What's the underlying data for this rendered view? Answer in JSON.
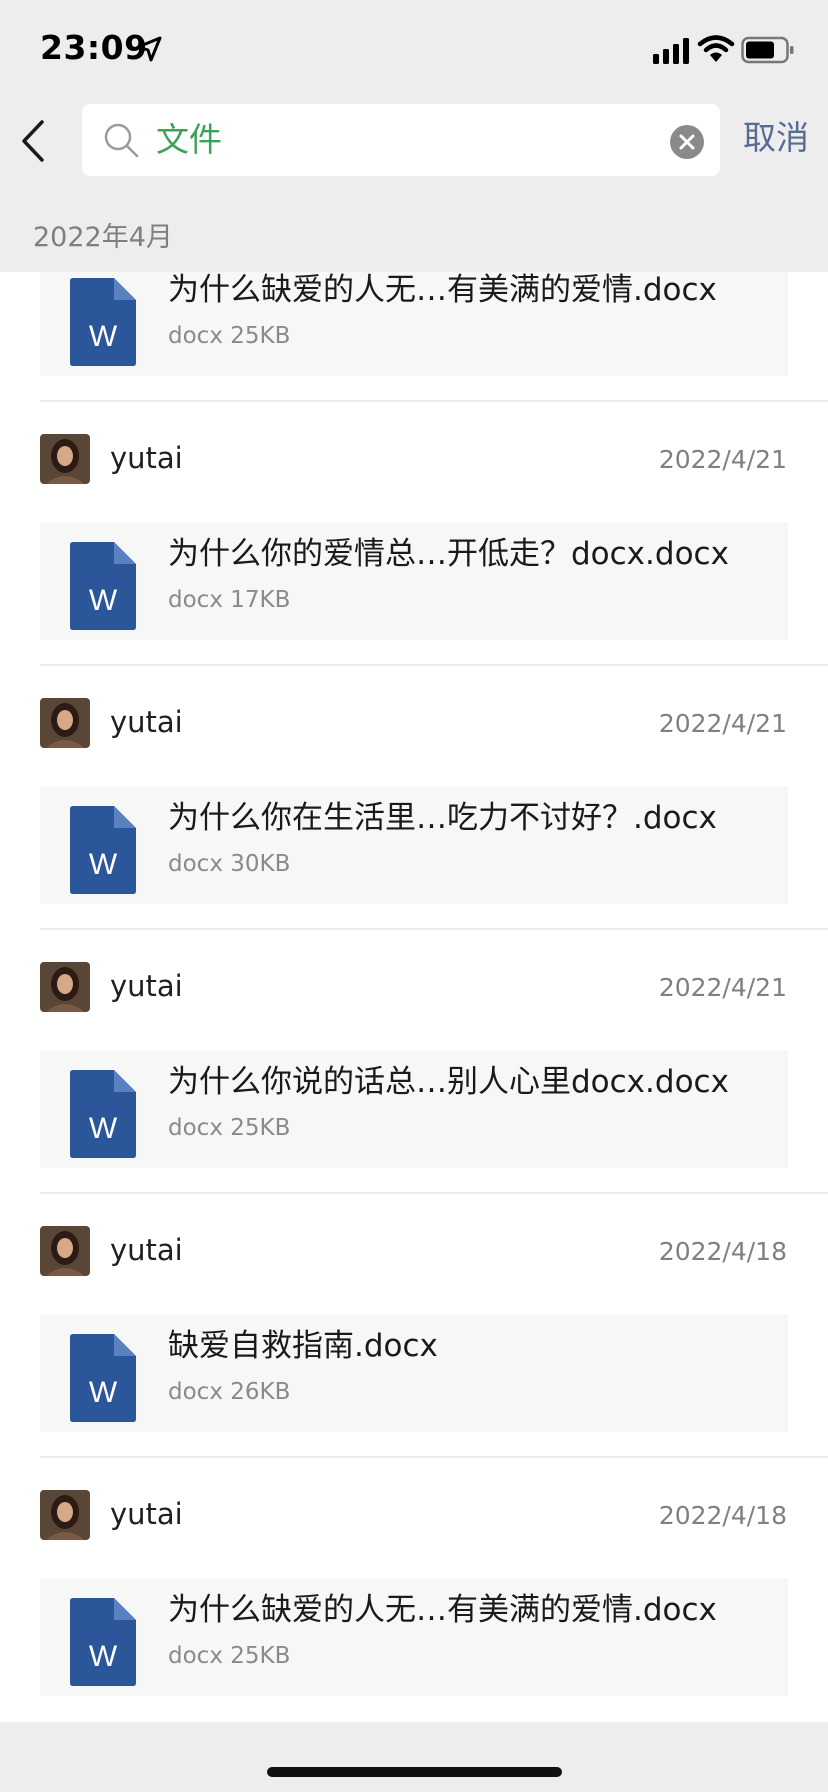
{
  "status_bar": {
    "time": "23:09",
    "location_icon": "location-arrow-icon",
    "signal_icon": "cellular-signal-icon",
    "wifi_icon": "wifi-icon",
    "battery_icon": "battery-icon"
  },
  "header": {
    "back_icon": "chevron-left-icon",
    "search_icon": "search-icon",
    "search_value": "文件",
    "clear_icon": "clear-circle-x-icon",
    "cancel_label": "取消"
  },
  "section": {
    "label": "2022年4月"
  },
  "colors": {
    "accent_green": "#3aa35a",
    "link_blue": "#576b95",
    "word_blue": "#2b579a",
    "header_bg": "#ededed",
    "card_bg": "#f7f7f7"
  },
  "files": [
    {
      "sender": "",
      "date": "",
      "name": "为什么缺爱的人无…有美满的爱情.docx",
      "meta": "docx 25KB",
      "icon": "word-document-icon"
    },
    {
      "sender": "yutai",
      "date": "2022/4/21",
      "name": "为什么你的爱情总…开低走？docx.docx",
      "meta": "docx 17KB",
      "icon": "word-document-icon"
    },
    {
      "sender": "yutai",
      "date": "2022/4/21",
      "name": "为什么你在生活里…吃力不讨好？.docx",
      "meta": "docx 30KB",
      "icon": "word-document-icon"
    },
    {
      "sender": "yutai",
      "date": "2022/4/21",
      "name": "为什么你说的话总…别人心里docx.docx",
      "meta": "docx 25KB",
      "icon": "word-document-icon"
    },
    {
      "sender": "yutai",
      "date": "2022/4/18",
      "name": "缺爱自救指南.docx",
      "meta": "docx 26KB",
      "icon": "word-document-icon"
    },
    {
      "sender": "yutai",
      "date": "2022/4/18",
      "name": "为什么缺爱的人无…有美满的爱情.docx",
      "meta": "docx 25KB",
      "icon": "word-document-icon"
    }
  ]
}
